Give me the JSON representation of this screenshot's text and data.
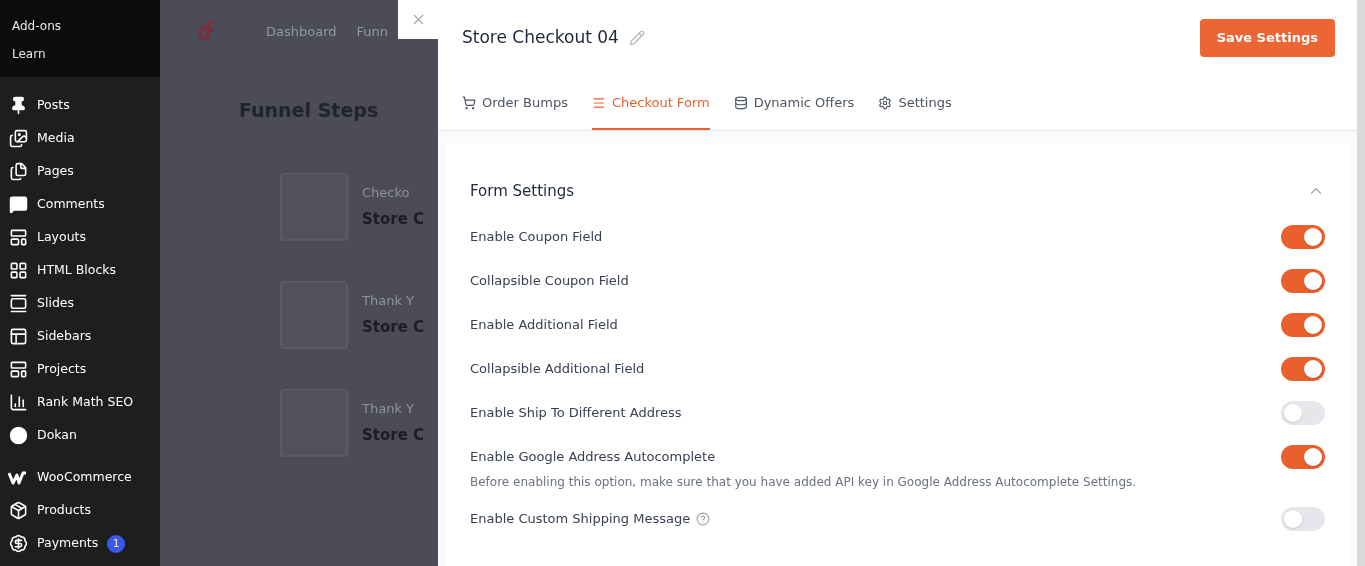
{
  "sidebar": {
    "top_items": [
      {
        "label": "Add-ons"
      },
      {
        "label": "Learn"
      }
    ],
    "items": [
      {
        "label": "Posts"
      },
      {
        "label": "Media"
      },
      {
        "label": "Pages"
      },
      {
        "label": "Comments"
      },
      {
        "label": "Layouts"
      },
      {
        "label": "HTML Blocks"
      },
      {
        "label": "Slides"
      },
      {
        "label": "Sidebars"
      },
      {
        "label": "Projects"
      },
      {
        "label": "Rank Math SEO"
      },
      {
        "label": "Dokan"
      },
      {
        "label": "WooCommerce"
      },
      {
        "label": "Products"
      },
      {
        "label": "Payments",
        "badge": "1"
      }
    ]
  },
  "background": {
    "nav": [
      "Dashboard",
      "Funn"
    ],
    "heading": "Funnel Steps",
    "steps": [
      {
        "type": "Checko",
        "name": "Store C"
      },
      {
        "type": "Thank Y",
        "name": "Store C"
      },
      {
        "type": "Thank Y",
        "name": "Store C"
      }
    ]
  },
  "panel": {
    "title": "Store Checkout 04",
    "save_button": "Save Settings",
    "tabs": [
      {
        "label": "Order Bumps",
        "selected": false
      },
      {
        "label": "Checkout Form",
        "selected": true
      },
      {
        "label": "Dynamic Offers",
        "selected": false
      },
      {
        "label": "Settings",
        "selected": false
      }
    ],
    "section": {
      "title": "Form Settings",
      "expanded": true,
      "settings": [
        {
          "label": "Enable Coupon Field",
          "on": true
        },
        {
          "label": "Collapsible Coupon Field",
          "on": true
        },
        {
          "label": "Enable Additional Field",
          "on": true
        },
        {
          "label": "Collapsible Additional Field",
          "on": true
        },
        {
          "label": "Enable Ship To Different Address",
          "on": false
        },
        {
          "label": "Enable Google Address Autocomplete",
          "on": true,
          "note": "Before enabling this option, make sure that you have added API key in Google Address Autocomplete Settings."
        },
        {
          "label": "Enable Custom Shipping Message",
          "on": false,
          "help": true
        }
      ]
    }
  }
}
